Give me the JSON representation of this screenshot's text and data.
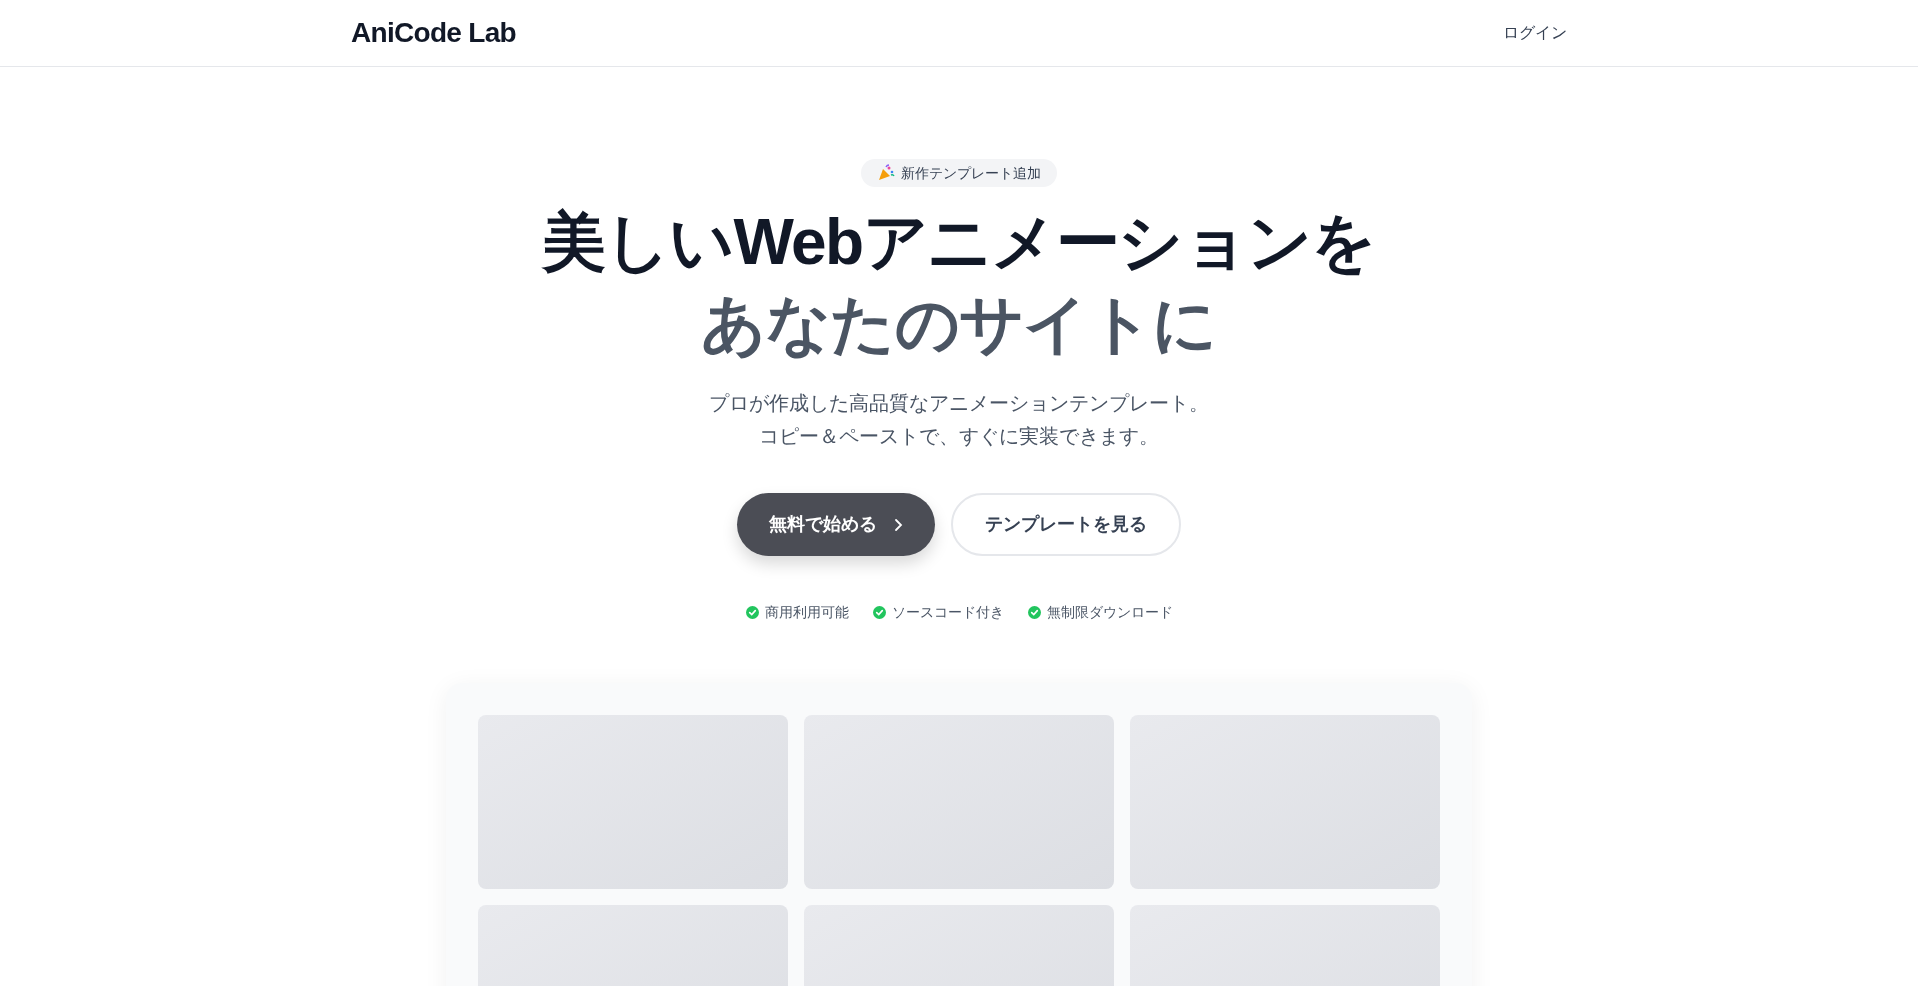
{
  "header": {
    "logo": "AniCode Lab",
    "login": "ログイン"
  },
  "hero": {
    "badge": "新作テンプレート追加",
    "title_lines": [
      "美しいWebアニメーションを",
      "あなたのサイトに"
    ],
    "subtitle_lines": [
      "プロが作成した高品質なアニメーションテンプレート。",
      "コピー＆ペーストで、すぐに実装できます。"
    ],
    "buttons": [
      {
        "label": "無料で始める",
        "kind": "primary"
      },
      {
        "label": "テンプレートを見る",
        "kind": "secondary"
      }
    ],
    "features": [
      "商用利用可能",
      "ソースコード付き",
      "無制限ダウンロード"
    ]
  },
  "preview_grid": {
    "cards": [
      {
        "kind": "placeholder"
      },
      {
        "kind": "placeholder"
      },
      {
        "kind": "placeholder"
      },
      {
        "kind": "placeholder"
      },
      {
        "kind": "placeholder"
      },
      {
        "kind": "placeholder"
      }
    ]
  }
}
